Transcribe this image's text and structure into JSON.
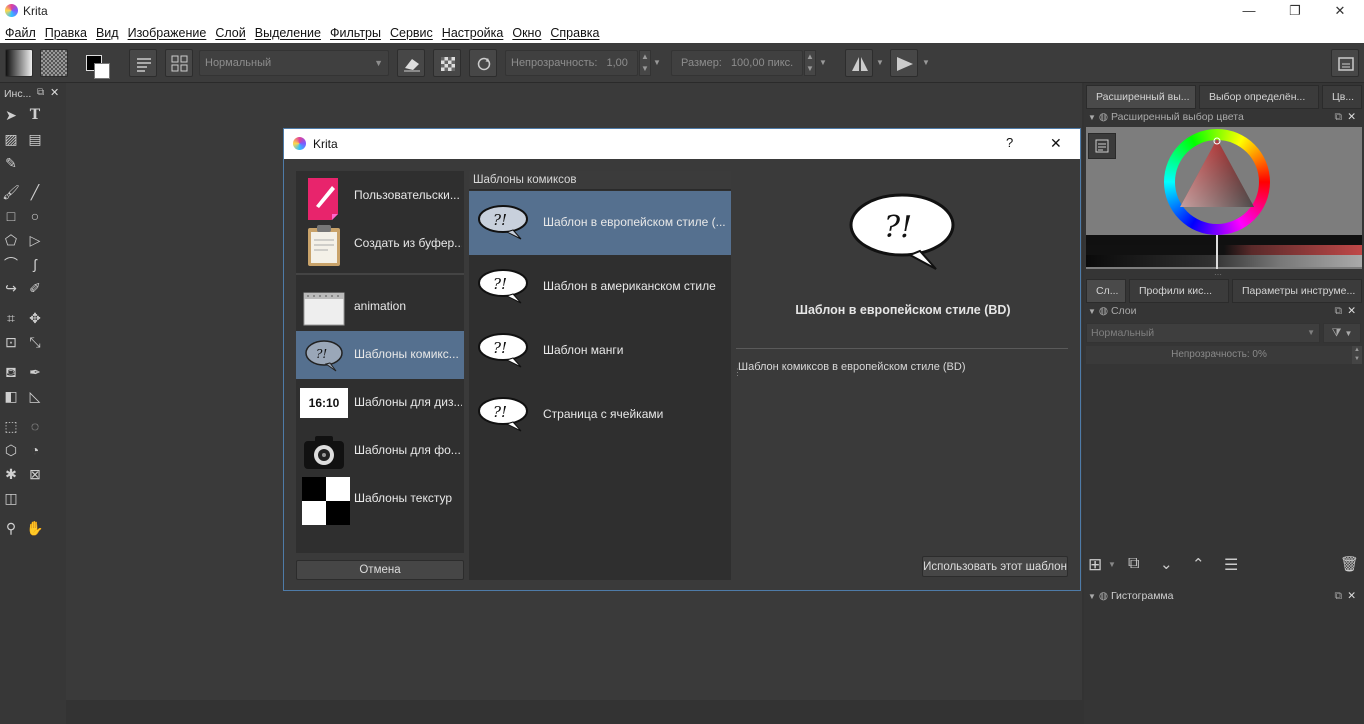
{
  "app": {
    "title": "Krita"
  },
  "menu": [
    "Файл",
    "Правка",
    "Вид",
    "Изображение",
    "Слой",
    "Выделение",
    "Фильтры",
    "Сервис",
    "Настройка",
    "Окно",
    "Справка"
  ],
  "toolbar": {
    "blend_mode": "Нормальный",
    "opacity_label": "Непрозрачность:",
    "opacity_value": "1,00",
    "size_label": "Размер:",
    "size_value": "100,00 пикс."
  },
  "toolbox": {
    "title": "Инс..."
  },
  "dock": {
    "top_tabs": [
      "Расширенный вы...",
      "Выбор определён...",
      "Цв..."
    ],
    "color_panel_title": "Расширенный выбор цвета",
    "mid_tabs": [
      "Сл...",
      "Профили кис...",
      "Параметры инструме..."
    ],
    "layers_title": "Слои",
    "layers_blend": "Нормальный",
    "layers_opacity": "Непрозрачность:  0%",
    "histogram_title": "Гистограмма"
  },
  "dialog": {
    "title": "Krita",
    "help": "?",
    "close": "✕",
    "categories": [
      {
        "label": "Пользовательски..."
      },
      {
        "label": "Создать из буфер..."
      },
      {
        "label": "animation"
      },
      {
        "label": "Шаблоны комикс..."
      },
      {
        "label": "Шаблоны для диз..."
      },
      {
        "label": "Шаблоны для фо..."
      },
      {
        "label": "Шаблоны текстур"
      }
    ],
    "design_thumb_text": "16:10",
    "cancel": "Отмена",
    "templates_header": "Шаблоны комиксов",
    "templates": [
      {
        "label": "Шаблон в европейском стиле (..."
      },
      {
        "label": "Шаблон в американском стиле"
      },
      {
        "label": "Шаблон манги"
      },
      {
        "label": "Страница с ячейками"
      }
    ],
    "bubble_text": "?!",
    "preview_title": "Шаблон в европейском стиле (BD)",
    "preview_desc": "Шаблон комиксов в европейском стиле (BD)",
    "use_button": "Использовать этот шаблон"
  }
}
